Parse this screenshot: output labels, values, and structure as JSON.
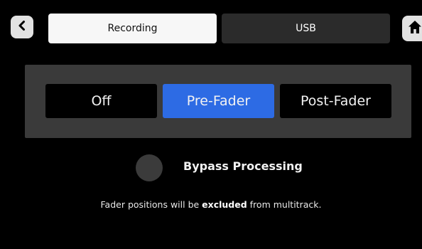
{
  "colors": {
    "background": "#000000",
    "panel": "#3a3a3a",
    "selected_accent": "#2d6be4",
    "tab_active": "#f7f7f7",
    "tab_inactive": "#2b2b2b",
    "toggle_off": "#3b3b3b"
  },
  "nav": {
    "back_icon": "chevron-left-icon",
    "home_icon": "home-icon"
  },
  "tabs": [
    {
      "label": "Recording",
      "active": true
    },
    {
      "label": "USB",
      "active": false
    }
  ],
  "tap_point": {
    "options": [
      {
        "label": "Off",
        "selected": false
      },
      {
        "label": "Pre-Fader",
        "selected": true
      },
      {
        "label": "Post-Fader",
        "selected": false
      }
    ]
  },
  "bypass": {
    "label": "Bypass Processing",
    "enabled": false
  },
  "info": {
    "before": "Fader positions will be ",
    "emphasis": "excluded",
    "after": " from multitrack."
  }
}
